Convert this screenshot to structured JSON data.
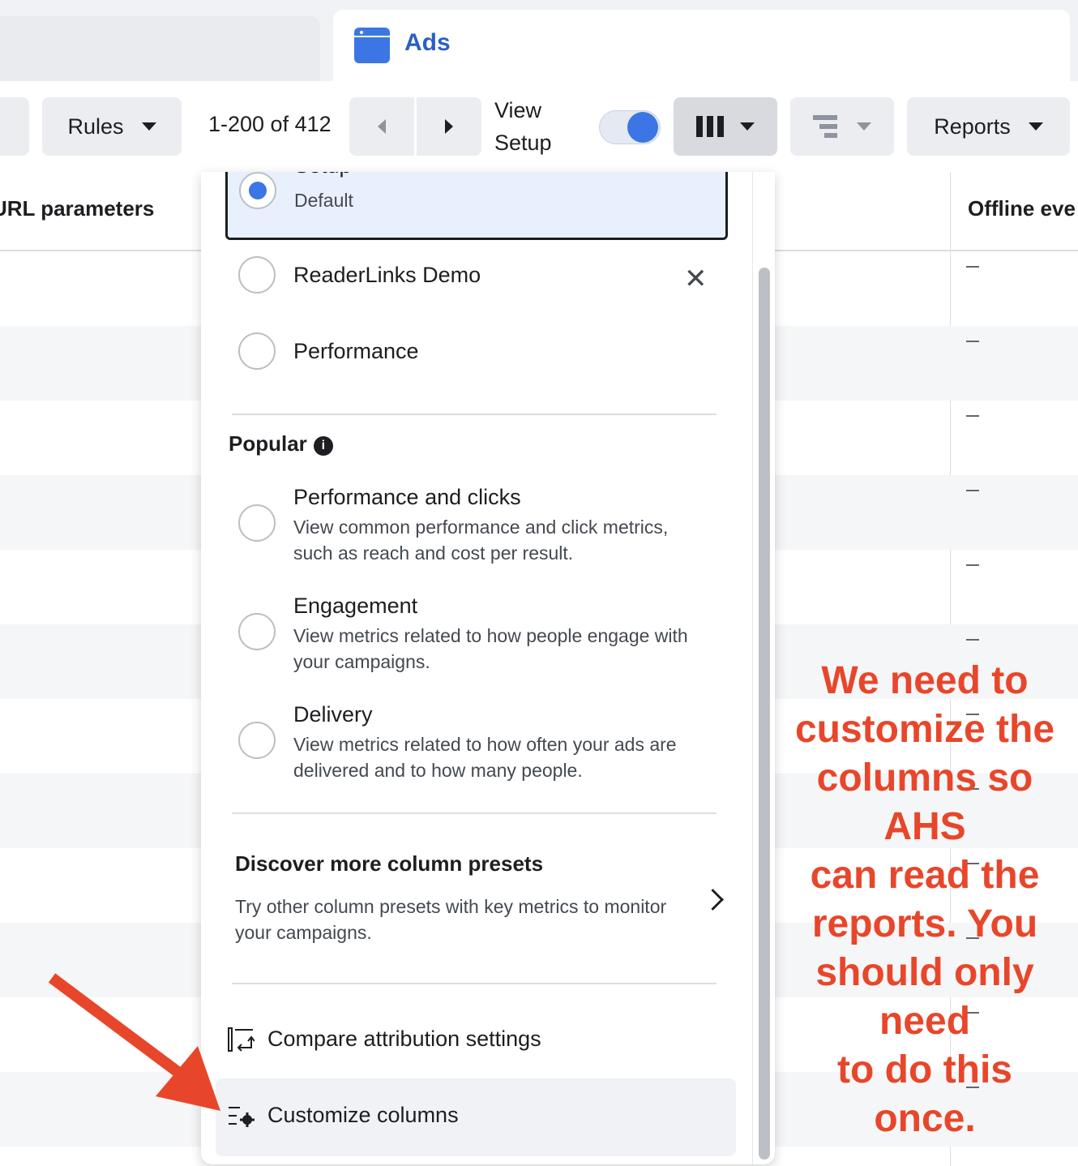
{
  "tabs": {
    "ads_title": "Ads"
  },
  "toolbar": {
    "rules_label": "Rules",
    "range_text": "1-200 of 412",
    "view_setup_line1": "View",
    "view_setup_line2": "Setup",
    "reports_label": "Reports",
    "toggle_on": true
  },
  "table": {
    "columns": [
      "URL parameters",
      "Offline eve"
    ],
    "cell_placeholder": "—",
    "row_count": 12
  },
  "presets_menu": {
    "selected": {
      "title": "Setup",
      "subtitle": "Default"
    },
    "items": [
      {
        "title": "ReaderLinks Demo",
        "removable": true
      },
      {
        "title": "Performance"
      }
    ],
    "popular_heading": "Popular",
    "popular": [
      {
        "title": "Performance and clicks",
        "desc_line1": "View common performance and click metrics,",
        "desc_line2": "such as reach and cost per result."
      },
      {
        "title": "Engagement",
        "desc_line1": "View metrics related to how people engage with",
        "desc_line2": "your campaigns."
      },
      {
        "title": "Delivery",
        "desc_line1": "View metrics related to how often your ads are",
        "desc_line2": "delivered and to how many people."
      }
    ],
    "discover_title": "Discover more column presets",
    "discover_line1": "Try other column presets with key metrics to monitor",
    "discover_line2": "your campaigns.",
    "compare_label": "Compare attribution settings",
    "customize_label": "Customize columns"
  },
  "annotation": {
    "lines": [
      "We need to",
      "customize the",
      "columns so",
      "AHS",
      "can read the",
      "reports. You",
      "should only",
      "need",
      "to do this",
      "once."
    ],
    "color": "#e8462a"
  },
  "colors": {
    "accent": "#3b76e4",
    "brand_text": "#2a5fc4"
  }
}
